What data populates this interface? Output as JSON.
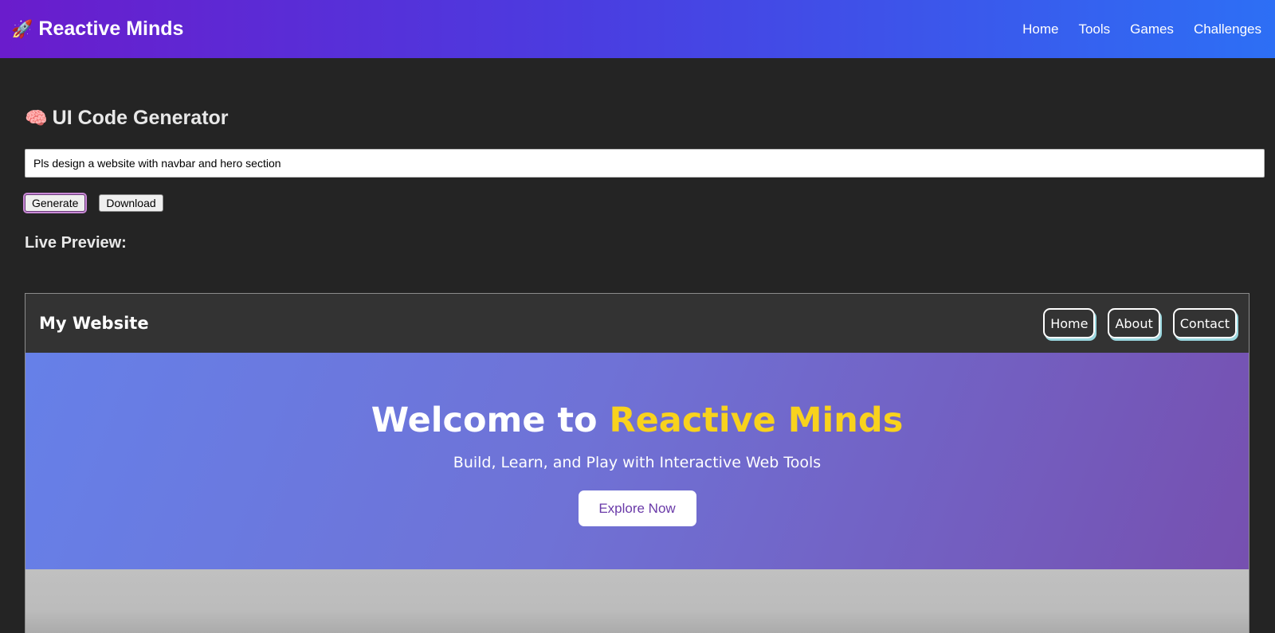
{
  "app": {
    "brand": "Reactive Minds",
    "brand_icon": "rocket-icon",
    "nav": [
      "Home",
      "Tools",
      "Games",
      "Challenges"
    ]
  },
  "generator": {
    "title": "UI Code Generator",
    "title_icon": "brain-icon",
    "prompt_value": "Pls design a website with navbar and hero section",
    "generate_label": "Generate",
    "download_label": "Download",
    "preview_label": "Live Preview:"
  },
  "preview": {
    "site_name": "My Website",
    "links": [
      "Home",
      "About",
      "Contact"
    ],
    "hero_title_prefix": "Welcome to ",
    "hero_title_accent": "Reactive Minds",
    "hero_subtitle": "Build, Learn, and Play with Interactive Web Tools",
    "cta_label": "Explore Now"
  },
  "colors": {
    "topbar_start": "#6a1ccc",
    "topbar_end": "#2d6ff5",
    "hero_accent": "#f8d21d",
    "cta_text": "#6a3aa8"
  }
}
